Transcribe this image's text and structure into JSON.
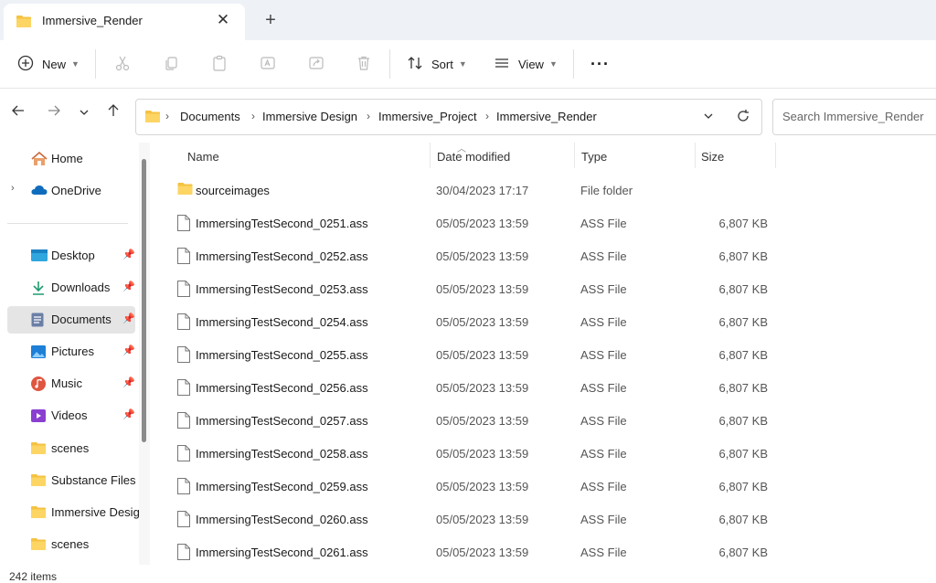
{
  "tab": {
    "title": "Immersive_Render"
  },
  "toolbar": {
    "new_label": "New",
    "sort_label": "Sort",
    "view_label": "View"
  },
  "address": {
    "crumbs": [
      "Documents",
      "Immersive Design",
      "Immersive_Project",
      "Immersive_Render"
    ]
  },
  "search": {
    "placeholder": "Search Immersive_Render"
  },
  "sidebar": {
    "items": [
      {
        "label": "Home",
        "icon": "home-icon"
      },
      {
        "label": "OneDrive",
        "icon": "cloud-icon"
      },
      {
        "label": "Desktop",
        "icon": "desktop-icon"
      },
      {
        "label": "Downloads",
        "icon": "download-icon"
      },
      {
        "label": "Documents",
        "icon": "document-icon"
      },
      {
        "label": "Pictures",
        "icon": "picture-icon"
      },
      {
        "label": "Music",
        "icon": "music-icon"
      },
      {
        "label": "Videos",
        "icon": "video-icon"
      },
      {
        "label": "scenes",
        "icon": "folder-icon"
      },
      {
        "label": "Substance Files",
        "icon": "folder-icon"
      },
      {
        "label": "Immersive Desig",
        "icon": "folder-icon"
      },
      {
        "label": "scenes",
        "icon": "folder-icon"
      }
    ]
  },
  "columns": {
    "name": "Name",
    "date": "Date modified",
    "type": "Type",
    "size": "Size"
  },
  "files": [
    {
      "name": "sourceimages",
      "date": "30/04/2023 17:17",
      "type": "File folder",
      "size": ""
    },
    {
      "name": "ImmersingTestSecond_0251.ass",
      "date": "05/05/2023 13:59",
      "type": "ASS File",
      "size": "6,807 KB"
    },
    {
      "name": "ImmersingTestSecond_0252.ass",
      "date": "05/05/2023 13:59",
      "type": "ASS File",
      "size": "6,807 KB"
    },
    {
      "name": "ImmersingTestSecond_0253.ass",
      "date": "05/05/2023 13:59",
      "type": "ASS File",
      "size": "6,807 KB"
    },
    {
      "name": "ImmersingTestSecond_0254.ass",
      "date": "05/05/2023 13:59",
      "type": "ASS File",
      "size": "6,807 KB"
    },
    {
      "name": "ImmersingTestSecond_0255.ass",
      "date": "05/05/2023 13:59",
      "type": "ASS File",
      "size": "6,807 KB"
    },
    {
      "name": "ImmersingTestSecond_0256.ass",
      "date": "05/05/2023 13:59",
      "type": "ASS File",
      "size": "6,807 KB"
    },
    {
      "name": "ImmersingTestSecond_0257.ass",
      "date": "05/05/2023 13:59",
      "type": "ASS File",
      "size": "6,807 KB"
    },
    {
      "name": "ImmersingTestSecond_0258.ass",
      "date": "05/05/2023 13:59",
      "type": "ASS File",
      "size": "6,807 KB"
    },
    {
      "name": "ImmersingTestSecond_0259.ass",
      "date": "05/05/2023 13:59",
      "type": "ASS File",
      "size": "6,807 KB"
    },
    {
      "name": "ImmersingTestSecond_0260.ass",
      "date": "05/05/2023 13:59",
      "type": "ASS File",
      "size": "6,807 KB"
    },
    {
      "name": "ImmersingTestSecond_0261.ass",
      "date": "05/05/2023 13:59",
      "type": "ASS File",
      "size": "6,807 KB"
    }
  ],
  "status": {
    "item_count": "242 items"
  },
  "colors": {
    "folder": "#f5c242",
    "accent": "#0067c0",
    "selected": "#e5e5e5"
  }
}
